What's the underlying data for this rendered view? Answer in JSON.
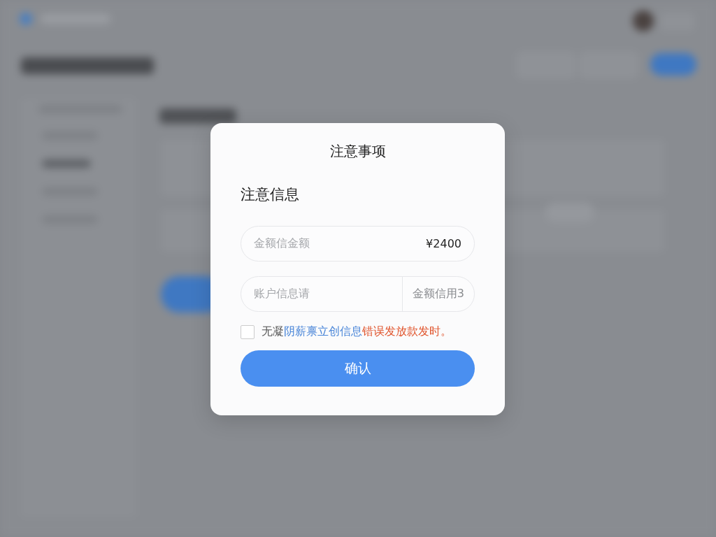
{
  "dialog": {
    "title": "注意事项",
    "heading": "注意信息",
    "amount_field": {
      "placeholder": "金额信金额",
      "value": "¥2400"
    },
    "account_field": {
      "placeholder": "账户信息请",
      "suffix": "金额信用3"
    },
    "agreement": {
      "checked": false,
      "parts": [
        {
          "kind": "plain",
          "text": "无凝"
        },
        {
          "kind": "link",
          "text": "阴薪禀立创信息"
        },
        {
          "kind": "warning",
          "text": "错误发放款发时。"
        }
      ]
    },
    "confirm_button": "确认"
  }
}
